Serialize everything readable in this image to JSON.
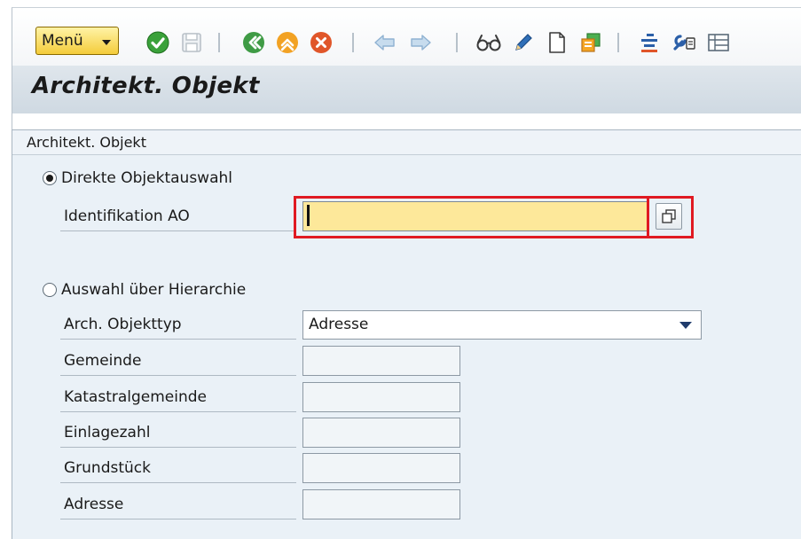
{
  "toolbar": {
    "menu_label": "Menü",
    "icons": [
      "check-icon",
      "save-icon",
      "back-icon",
      "exit-icon",
      "cancel-icon",
      "arrow-left-icon",
      "arrow-right-icon",
      "glasses-icon",
      "pencil-icon",
      "new-document-icon",
      "copy-stack-icon",
      "list-icon",
      "settings-wrench-icon",
      "table-icon"
    ]
  },
  "header": {
    "title": "Architekt. Objekt"
  },
  "group": {
    "title": "Architekt. Objekt",
    "direct": {
      "label": "Direkte Objektauswahl",
      "selected": true,
      "field_label": "Identifikation AO",
      "value": ""
    },
    "hierarchy": {
      "label": "Auswahl über Hierarchie",
      "selected": false,
      "type_label": "Arch. Objekttyp",
      "type_value": "Adresse",
      "fields": [
        {
          "label": "Gemeinde",
          "value": ""
        },
        {
          "label": "Katastralgemeinde",
          "value": ""
        },
        {
          "label": "Einlagezahl",
          "value": ""
        },
        {
          "label": "Grundstück",
          "value": ""
        },
        {
          "label": "Adresse",
          "value": ""
        }
      ]
    }
  },
  "colors": {
    "menu_button": "#f4cc3a",
    "highlight_frame": "#e01a22",
    "input_required": "#fde89a",
    "group_background": "#eaf1f7"
  }
}
